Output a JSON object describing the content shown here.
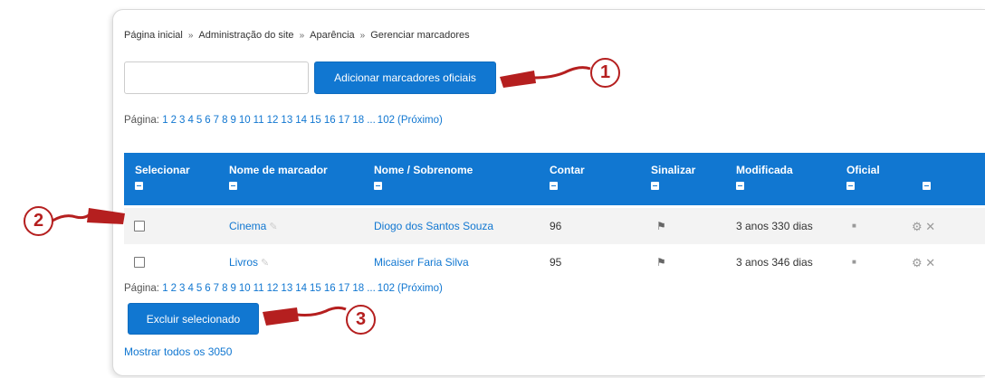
{
  "breadcrumb": [
    "Página inicial",
    "Administração do site",
    "Aparência",
    "Gerenciar marcadores"
  ],
  "breadcrumb_separator": "»",
  "tag_input": {
    "value": "",
    "placeholder": ""
  },
  "add_button_label": "Adicionar marcadores oficiais",
  "paging": {
    "label": "Página:",
    "pages": [
      "1",
      "2",
      "3",
      "4",
      "5",
      "6",
      "7",
      "8",
      "9",
      "10",
      "11",
      "12",
      "13",
      "14",
      "15",
      "16",
      "17",
      "18"
    ],
    "ellipsis": "...",
    "last": "102",
    "next": "(Próximo)"
  },
  "table": {
    "headers": [
      "Selecionar",
      "Nome de marcador",
      "Nome / Sobrenome",
      "Contar",
      "Sinalizar",
      "Modificada",
      "Oficial"
    ],
    "rows": [
      {
        "tag": "Cinema",
        "owner": "Diogo dos Santos Souza",
        "count": "96",
        "modified": "3 anos 330 dias"
      },
      {
        "tag": "Livros",
        "owner": "Micaiser Faria Silva",
        "count": "95",
        "modified": "3 anos 346 dias"
      }
    ]
  },
  "delete_button_label": "Excluir selecionado",
  "show_all_link": "Mostrar todos os 3050",
  "callouts": [
    "1",
    "2",
    "3"
  ],
  "colors": {
    "accent": "#1177d1",
    "callout": "#b51f1f",
    "row_alt": "#f3f3f3"
  }
}
